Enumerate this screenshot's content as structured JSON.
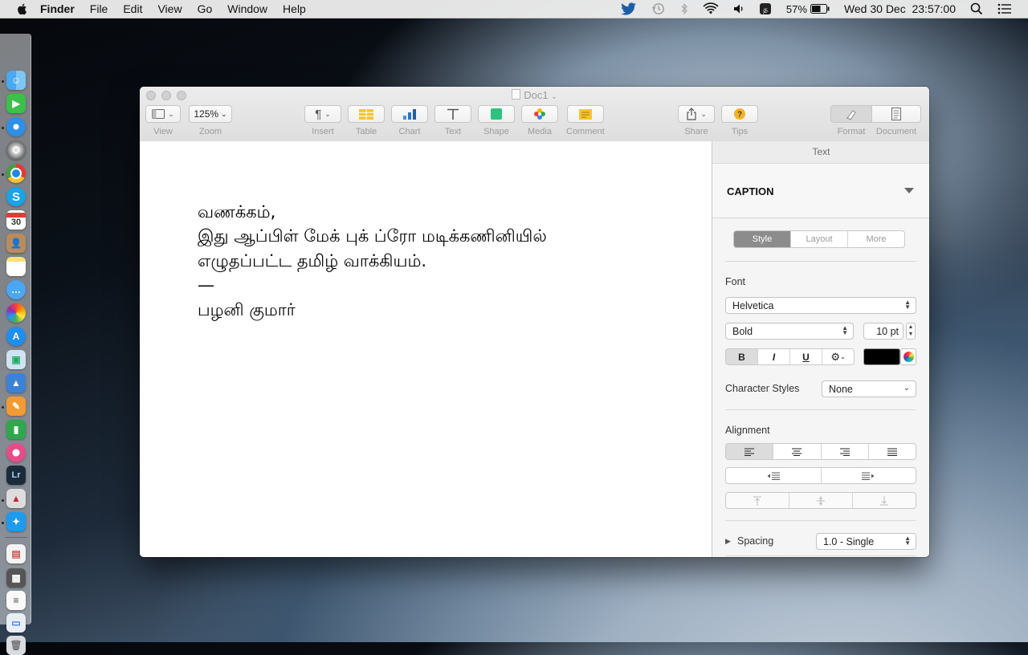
{
  "menubar": {
    "app": "Finder",
    "items": [
      "File",
      "Edit",
      "View",
      "Go",
      "Window",
      "Help"
    ],
    "battery": "57%",
    "clock": "Wed 30 Dec  23:57:00"
  },
  "dock": {
    "apps": [
      "finder",
      "facetime",
      "safari",
      "system-preferences",
      "chrome",
      "skype",
      "calendar",
      "contacts",
      "notes",
      "messages",
      "photos",
      "app-store",
      "preview",
      "keynote",
      "pages",
      "numbers",
      "itunes",
      "lightroom",
      "santa-app",
      "twitter",
      "documents",
      "screenshots",
      "file-list",
      "folder",
      "trash"
    ],
    "calendar_day": "30",
    "lightroom_label": "Lr"
  },
  "window": {
    "title": "Doc1",
    "toolbar": {
      "view": "View",
      "zoom_value": "125%",
      "zoom": "Zoom",
      "insert": "Insert",
      "table": "Table",
      "chart": "Chart",
      "text": "Text",
      "shape": "Shape",
      "media": "Media",
      "comment": "Comment",
      "share": "Share",
      "tips": "Tips",
      "format": "Format",
      "document": "Document"
    },
    "document_lines": [
      "வணக்கம்,",
      "இது ஆப்பிள் மேக் புக் ப்ரோ மடிக்கணினியில்",
      "எழுதப்பட்ட தமிழ் வாக்கியம்.",
      "—",
      "பழனி குமார்"
    ]
  },
  "inspector": {
    "header": "Text",
    "paragraph_style": "CAPTION",
    "tabs": [
      "Style",
      "Layout",
      "More"
    ],
    "active_tab": "Style",
    "font_label": "Font",
    "font_family": "Helvetica",
    "font_style": "Bold",
    "font_size": "10 pt",
    "format_buttons": [
      "B",
      "I",
      "U"
    ],
    "text_color": "#000000",
    "char_styles_label": "Character Styles",
    "char_styles_value": "None",
    "alignment_label": "Alignment",
    "spacing_label": "Spacing",
    "spacing_value": "1.0 - Single"
  }
}
